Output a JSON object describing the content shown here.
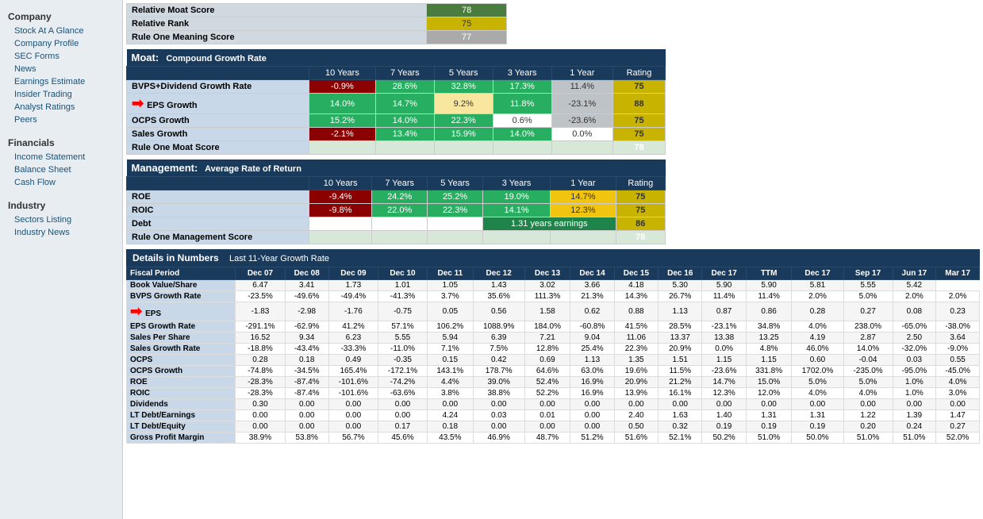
{
  "sidebar": {
    "company_header": "Company",
    "items_company": [
      "Stock At A Glance",
      "Company Profile",
      "SEC Forms",
      "News",
      "Earnings Estimate",
      "Insider Trading",
      "Analyst Ratings",
      "Peers"
    ],
    "financials_header": "Financials",
    "items_financials": [
      "Income Statement",
      "Balance Sheet",
      "Cash Flow"
    ],
    "industry_header": "Industry",
    "items_industry": [
      "Sectors Listing",
      "Industry News"
    ]
  },
  "top_scores": [
    {
      "label": "Relative Moat Score",
      "value": "78",
      "style": "green"
    },
    {
      "label": "Relative Rank",
      "value": "75",
      "style": "yellow"
    },
    {
      "label": "Rule One Meaning Score",
      "value": "77",
      "style": "gray"
    }
  ],
  "moat": {
    "title": "Moat:",
    "subtitle": "Compound Growth Rate",
    "columns": [
      "10 Years",
      "7 Years",
      "5 Years",
      "3 Years",
      "1 Year",
      "Rating"
    ],
    "rows": [
      {
        "label": "BVPS+Dividend Growth Rate",
        "values": [
          "-0.9%",
          "28.6%",
          "32.8%",
          "17.3%",
          "11.4%"
        ],
        "rating": "75",
        "styles": [
          "cell-dark-red",
          "cell-green",
          "cell-green",
          "cell-green",
          "cell-gray"
        ],
        "rating_style": "rating-yellow"
      },
      {
        "label": "EPS Growth",
        "values": [
          "14.0%",
          "14.7%",
          "9.2%",
          "11.8%",
          "-23.1%"
        ],
        "rating": "88",
        "styles": [
          "cell-green",
          "cell-green",
          "cell-light-yellow",
          "cell-green",
          "cell-gray"
        ],
        "rating_style": "rating-yellow",
        "has_arrow": true
      },
      {
        "label": "OCPS Growth",
        "values": [
          "15.2%",
          "14.0%",
          "22.3%",
          "0.6%",
          "-23.6%"
        ],
        "rating": "75",
        "styles": [
          "cell-green",
          "cell-green",
          "cell-green",
          "cell-white",
          "cell-gray"
        ],
        "rating_style": "rating-yellow"
      },
      {
        "label": "Sales Growth",
        "values": [
          "-2.1%",
          "13.4%",
          "15.9%",
          "14.0%",
          "0.0%"
        ],
        "rating": "75",
        "styles": [
          "cell-dark-red",
          "cell-green",
          "cell-green",
          "cell-green",
          "cell-white"
        ],
        "rating_style": "rating-yellow"
      },
      {
        "label": "Rule One Moat Score",
        "values": [
          "",
          "",
          "",
          "",
          ""
        ],
        "rating": "78",
        "styles": [
          "cell-white",
          "cell-white",
          "cell-white",
          "cell-white",
          "cell-white"
        ],
        "rating_style": "rating-green",
        "is_total": true
      }
    ]
  },
  "management": {
    "title": "Management:",
    "subtitle": "Average Rate of Return",
    "columns": [
      "10 Years",
      "7 Years",
      "5 Years",
      "3 Years",
      "1 Year",
      "Rating"
    ],
    "rows": [
      {
        "label": "ROE",
        "values": [
          "-9.4%",
          "24.2%",
          "25.2%",
          "19.0%",
          "14.7%"
        ],
        "rating": "75",
        "styles": [
          "cell-dark-red",
          "cell-green",
          "cell-green",
          "cell-green",
          "cell-yellow"
        ],
        "rating_style": "rating-yellow"
      },
      {
        "label": "ROIC",
        "values": [
          "-9.8%",
          "22.0%",
          "22.3%",
          "14.1%",
          "12.3%"
        ],
        "rating": "75",
        "styles": [
          "cell-dark-red",
          "cell-green",
          "cell-green",
          "cell-green",
          "cell-yellow"
        ],
        "rating_style": "rating-yellow"
      },
      {
        "label": "Debt",
        "values": [
          "",
          "",
          "",
          "1.31 years earnings",
          ""
        ],
        "rating": "86",
        "styles": [
          "cell-white",
          "cell-white",
          "cell-white",
          "cell-dark-green",
          "cell-white"
        ],
        "rating_style": "rating-yellow",
        "debt_row": true
      },
      {
        "label": "Rule One Management Score",
        "values": [
          "",
          "",
          "",
          "",
          ""
        ],
        "rating": "78",
        "styles": [
          "cell-white",
          "cell-white",
          "cell-white",
          "cell-white",
          "cell-white"
        ],
        "rating_style": "rating-green",
        "is_total": true
      }
    ]
  },
  "details": {
    "header": "Details in Numbers",
    "subheader": "Last 11-Year Growth Rate",
    "columns": [
      "Fiscal Period",
      "Dec 07",
      "Dec 08",
      "Dec 09",
      "Dec 10",
      "Dec 11",
      "Dec 12",
      "Dec 13",
      "Dec 14",
      "Dec 15",
      "Dec 16",
      "Dec 17",
      "TTM",
      "Dec 17",
      "Sep 17",
      "Jun 17",
      "Mar 17"
    ],
    "rows": [
      {
        "label": "Book Value/Share",
        "values": [
          "6.47",
          "3.41",
          "1.73",
          "1.01",
          "1.05",
          "1.43",
          "3.02",
          "3.66",
          "4.18",
          "5.30",
          "5.90",
          "5.90",
          "5.81",
          "5.55",
          "5.42"
        ]
      },
      {
        "label": "BVPS Growth Rate",
        "values": [
          "-23.5%",
          "-49.6%",
          "-49.4%",
          "-41.3%",
          "3.7%",
          "35.6%",
          "111.3%",
          "21.3%",
          "14.3%",
          "26.7%",
          "11.4%",
          "11.4%",
          "2.0%",
          "5.0%",
          "2.0%",
          "2.0%"
        ]
      },
      {
        "label": "EPS",
        "values": [
          "-1.83",
          "-2.98",
          "-1.76",
          "-0.75",
          "0.05",
          "0.56",
          "1.58",
          "0.62",
          "0.88",
          "1.13",
          "0.87",
          "0.86",
          "0.28",
          "0.27",
          "0.08",
          "0.23"
        ],
        "has_arrow": true
      },
      {
        "label": "EPS Growth Rate",
        "values": [
          "-291.1%",
          "-62.9%",
          "41.2%",
          "57.1%",
          "106.2%",
          "1088.9%",
          "184.0%",
          "-60.8%",
          "41.5%",
          "28.5%",
          "-23.1%",
          "34.8%",
          "4.0%",
          "238.0%",
          "-65.0%",
          "-38.0%"
        ]
      },
      {
        "label": "Sales Per Share",
        "values": [
          "16.52",
          "9.34",
          "6.23",
          "5.55",
          "5.94",
          "6.39",
          "7.21",
          "9.04",
          "11.06",
          "13.37",
          "13.38",
          "13.25",
          "4.19",
          "2.87",
          "2.50",
          "3.64"
        ]
      },
      {
        "label": "Sales Growth Rate",
        "values": [
          "-18.8%",
          "-43.4%",
          "-33.3%",
          "-11.0%",
          "7.1%",
          "7.5%",
          "12.8%",
          "25.4%",
          "22.3%",
          "20.9%",
          "0.0%",
          "4.8%",
          "46.0%",
          "14.0%",
          "-32.0%",
          "-9.0%"
        ]
      },
      {
        "label": "OCPS",
        "values": [
          "0.28",
          "0.18",
          "0.49",
          "-0.35",
          "0.15",
          "0.42",
          "0.69",
          "1.13",
          "1.35",
          "1.51",
          "1.15",
          "1.15",
          "0.60",
          "-0.04",
          "0.03",
          "0.55"
        ]
      },
      {
        "label": "OCPS Growth",
        "values": [
          "-74.8%",
          "-34.5%",
          "165.4%",
          "-172.1%",
          "143.1%",
          "178.7%",
          "64.6%",
          "63.0%",
          "19.6%",
          "11.5%",
          "-23.6%",
          "331.8%",
          "1702.0%",
          "-235.0%",
          "-95.0%",
          "-45.0%"
        ]
      },
      {
        "label": "ROE",
        "values": [
          "-28.3%",
          "-87.4%",
          "-101.6%",
          "-74.2%",
          "4.4%",
          "39.0%",
          "52.4%",
          "16.9%",
          "20.9%",
          "21.2%",
          "14.7%",
          "15.0%",
          "5.0%",
          "5.0%",
          "1.0%",
          "4.0%"
        ]
      },
      {
        "label": "ROIC",
        "values": [
          "-28.3%",
          "-87.4%",
          "-101.6%",
          "-63.6%",
          "3.8%",
          "38.8%",
          "52.2%",
          "16.9%",
          "13.9%",
          "16.1%",
          "12.3%",
          "12.0%",
          "4.0%",
          "4.0%",
          "1.0%",
          "3.0%"
        ]
      },
      {
        "label": "Dividends",
        "values": [
          "0.30",
          "0.00",
          "0.00",
          "0.00",
          "0.00",
          "0.00",
          "0.00",
          "0.00",
          "0.00",
          "0.00",
          "0.00",
          "0.00",
          "0.00",
          "0.00",
          "0.00",
          "0.00"
        ]
      },
      {
        "label": "LT Debt/Earnings",
        "values": [
          "0.00",
          "0.00",
          "0.00",
          "0.00",
          "4.24",
          "0.03",
          "0.01",
          "0.00",
          "2.40",
          "1.63",
          "1.40",
          "1.31",
          "1.31",
          "1.22",
          "1.39",
          "1.47"
        ]
      },
      {
        "label": "LT Debt/Equity",
        "values": [
          "0.00",
          "0.00",
          "0.00",
          "0.17",
          "0.18",
          "0.00",
          "0.00",
          "0.00",
          "0.50",
          "0.32",
          "0.19",
          "0.19",
          "0.19",
          "0.20",
          "0.24",
          "0.27"
        ]
      },
      {
        "label": "Gross Profit Margin",
        "values": [
          "38.9%",
          "53.8%",
          "56.7%",
          "45.6%",
          "43.5%",
          "46.9%",
          "48.7%",
          "51.2%",
          "51.6%",
          "52.1%",
          "50.2%",
          "51.0%",
          "50.0%",
          "51.0%",
          "51.0%",
          "52.0%"
        ]
      }
    ]
  }
}
